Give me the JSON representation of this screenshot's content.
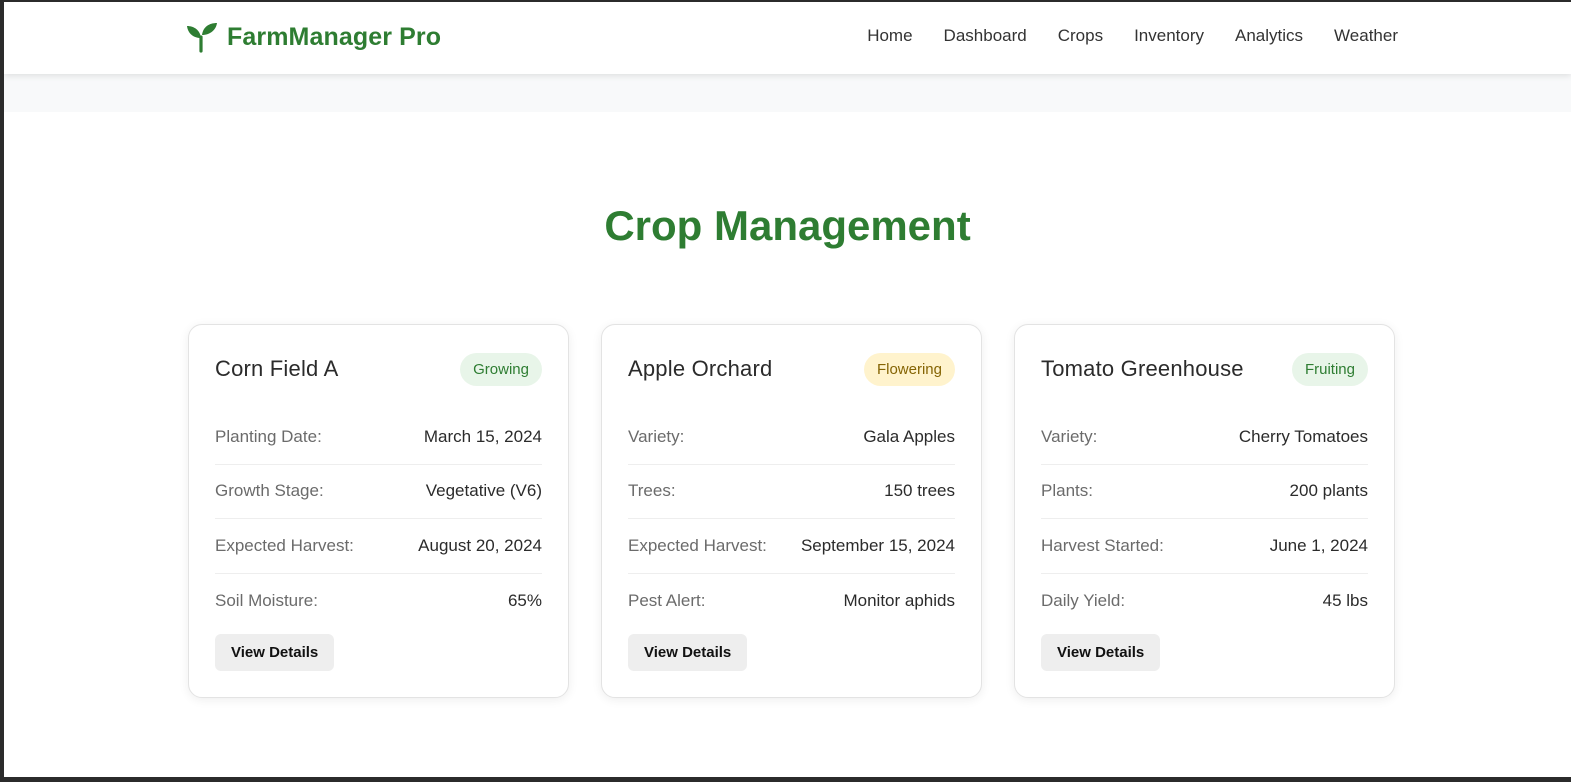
{
  "brand": {
    "name": "FarmManager Pro",
    "icon": "sprout-icon",
    "color": "#2e7d32"
  },
  "nav": [
    {
      "label": "Home"
    },
    {
      "label": "Dashboard"
    },
    {
      "label": "Crops"
    },
    {
      "label": "Inventory"
    },
    {
      "label": "Analytics"
    },
    {
      "label": "Weather"
    }
  ],
  "page": {
    "title": "Crop Management"
  },
  "cards": [
    {
      "title": "Corn Field A",
      "status": "Growing",
      "rows": [
        {
          "label": "Planting Date:",
          "value": "March 15, 2024"
        },
        {
          "label": "Growth Stage:",
          "value": "Vegetative (V6)"
        },
        {
          "label": "Expected Harvest:",
          "value": "August 20, 2024"
        },
        {
          "label": "Soil Moisture:",
          "value": "65%"
        }
      ],
      "button": "View Details"
    },
    {
      "title": "Apple Orchard",
      "status": "Flowering",
      "rows": [
        {
          "label": "Variety:",
          "value": "Gala Apples"
        },
        {
          "label": "Trees:",
          "value": "150 trees"
        },
        {
          "label": "Expected Harvest:",
          "value": "September 15, 2024"
        },
        {
          "label": "Pest Alert:",
          "value": "Monitor aphids"
        }
      ],
      "button": "View Details"
    },
    {
      "title": "Tomato Greenhouse",
      "status": "Fruiting",
      "rows": [
        {
          "label": "Variety:",
          "value": "Cherry Tomatoes"
        },
        {
          "label": "Plants:",
          "value": "200 plants"
        },
        {
          "label": "Harvest Started:",
          "value": "June 1, 2024"
        },
        {
          "label": "Daily Yield:",
          "value": "45 lbs"
        }
      ],
      "button": "View Details"
    }
  ]
}
